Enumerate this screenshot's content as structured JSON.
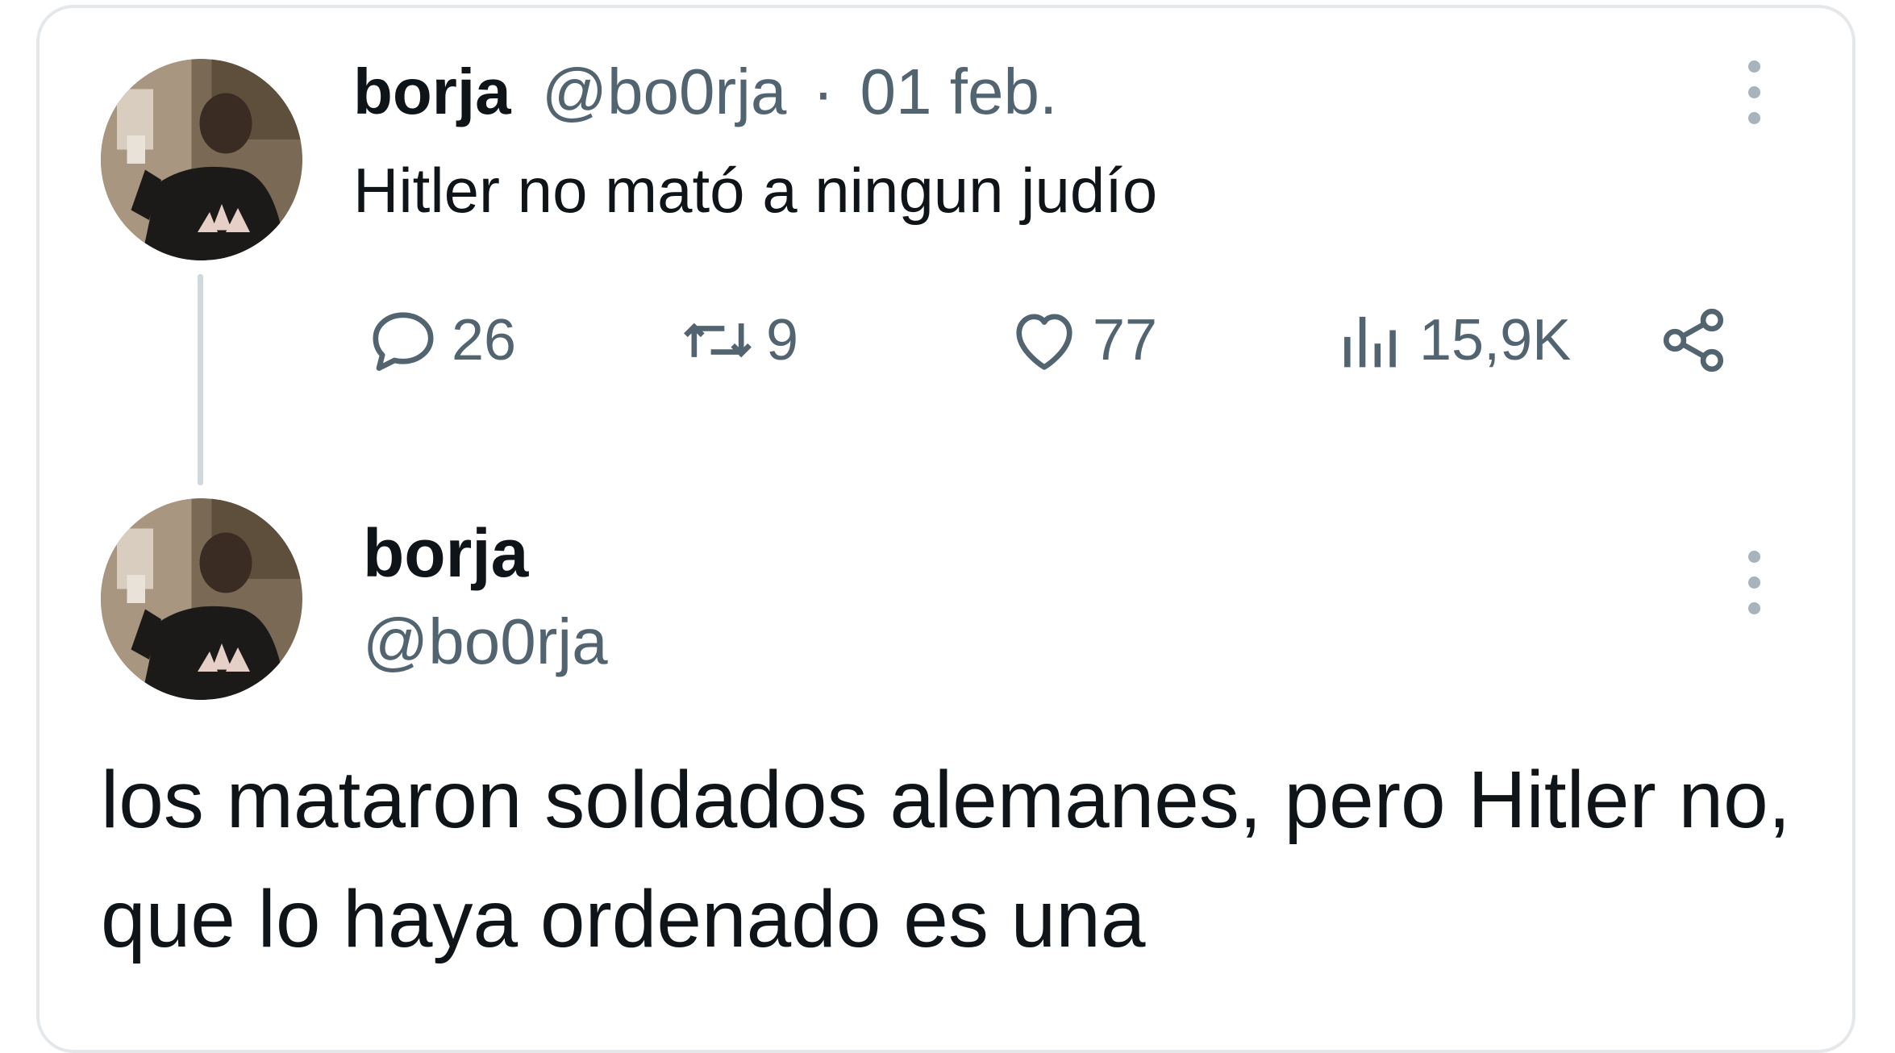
{
  "tweet_main": {
    "author_name": "borja",
    "author_handle": "@bo0rja",
    "separator": "·",
    "date": "01 feb.",
    "text": "Hitler no mató a ningun judío",
    "actions": {
      "replies": "26",
      "reposts": "9",
      "likes": "77",
      "views": "15,9K"
    }
  },
  "tweet_reply": {
    "author_name": "borja",
    "author_handle": "@bo0rja",
    "text": "los mataron soldados alemanes, pero Hitler no, que lo haya ordenado es una"
  },
  "icons": {
    "reply": "reply-icon",
    "repost": "repost-icon",
    "like": "heart-icon",
    "views": "views-icon",
    "share": "share-icon",
    "more": "more-options-icon"
  },
  "colors": {
    "text": "#0f1419",
    "muted": "#536471",
    "border": "#e4e8eb",
    "thread_line": "#cfd9de"
  }
}
